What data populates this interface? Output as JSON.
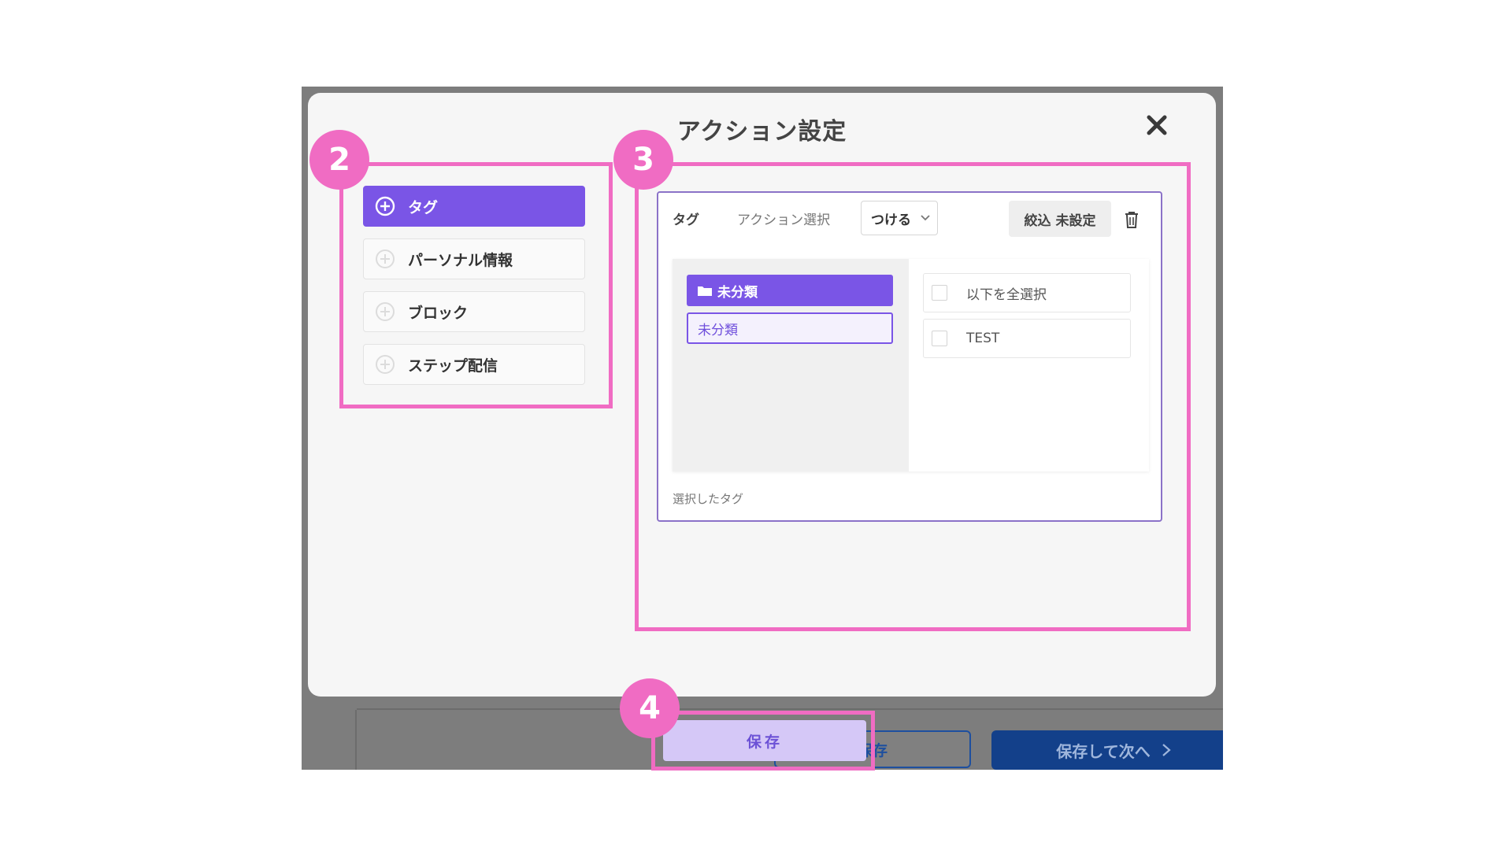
{
  "modal": {
    "title": "アクション設定",
    "close_icon": "close-icon"
  },
  "categories": [
    {
      "label": "タグ",
      "icon": "plus-circle-icon",
      "active": true
    },
    {
      "label": "パーソナル情報",
      "icon": "plus-circle-icon",
      "active": false
    },
    {
      "label": "ブロック",
      "icon": "plus-circle-icon",
      "active": false
    },
    {
      "label": "ステップ配信",
      "icon": "plus-circle-icon",
      "active": false
    }
  ],
  "action": {
    "tag_label": "タグ",
    "action_select_label": "アクション選択",
    "select_value": "つける",
    "filter_label": "絞込 未設定",
    "folder_label": "未分類",
    "folder_sub_label": "未分類",
    "options": [
      {
        "label": "以下を全選択",
        "checked": false
      },
      {
        "label": "TEST",
        "checked": false
      }
    ],
    "selected_tags_label": "選択したタグ"
  },
  "background": {
    "secondary_button": "保存",
    "primary_button": "保存して次へ",
    "primary_button_icon": "chevron-right-icon"
  },
  "save_button": "保存",
  "annotations": {
    "badge_2": "2",
    "badge_3": "3",
    "badge_4": "4",
    "color": "#f06cc3"
  },
  "colors": {
    "accent": "#7a55e6",
    "save_bg": "#d5c8f7",
    "primary_bg": "#13408a"
  }
}
